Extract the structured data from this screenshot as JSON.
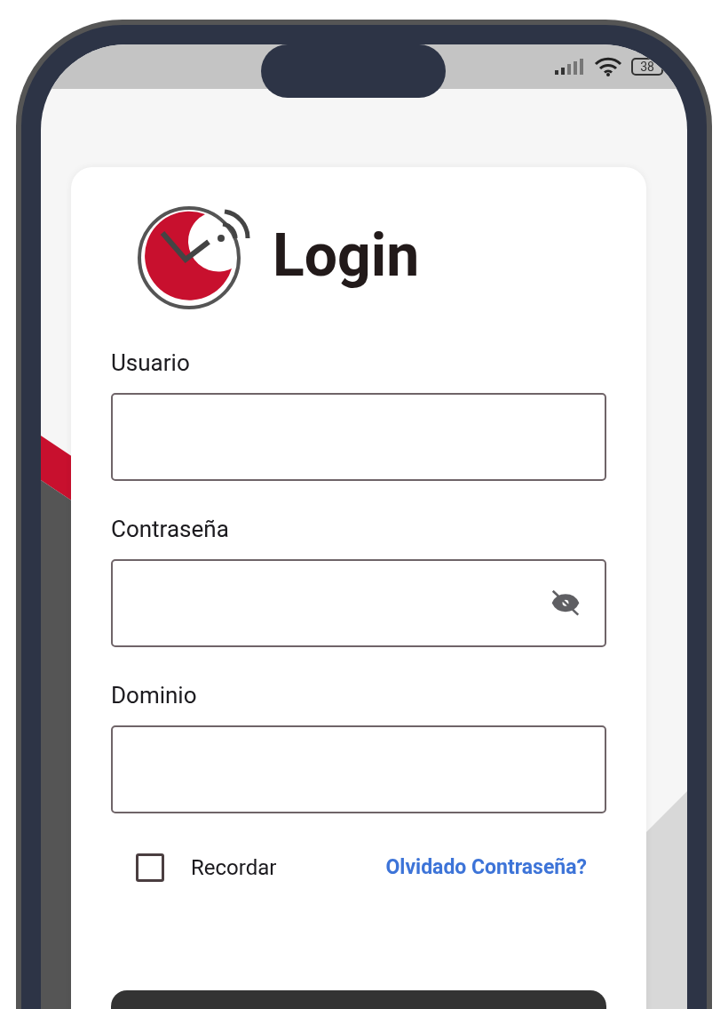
{
  "status_bar": {
    "battery": "38"
  },
  "title": "Login",
  "fields": [
    {
      "label": "Usuario",
      "kind": "text"
    },
    {
      "label": "Contraseña",
      "kind": "password"
    },
    {
      "label": "Dominio",
      "kind": "text"
    }
  ],
  "remember": {
    "label": "Recordar",
    "checked": false
  },
  "forgot_link": "Olvidado Contraseña?"
}
